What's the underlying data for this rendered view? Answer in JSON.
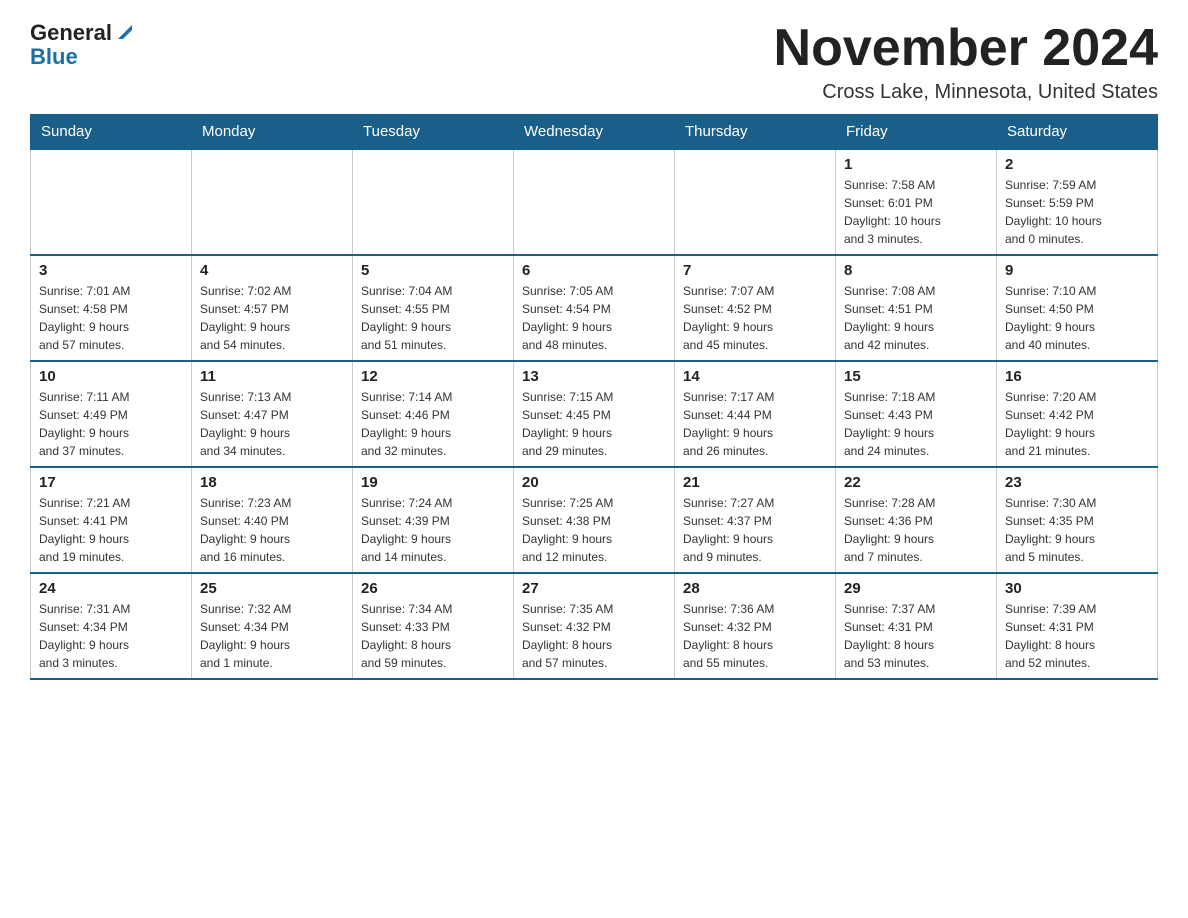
{
  "header": {
    "logo_general": "General",
    "logo_blue": "Blue",
    "title": "November 2024",
    "subtitle": "Cross Lake, Minnesota, United States"
  },
  "weekdays": [
    "Sunday",
    "Monday",
    "Tuesday",
    "Wednesday",
    "Thursday",
    "Friday",
    "Saturday"
  ],
  "weeks": [
    [
      {
        "day": "",
        "info": ""
      },
      {
        "day": "",
        "info": ""
      },
      {
        "day": "",
        "info": ""
      },
      {
        "day": "",
        "info": ""
      },
      {
        "day": "",
        "info": ""
      },
      {
        "day": "1",
        "info": "Sunrise: 7:58 AM\nSunset: 6:01 PM\nDaylight: 10 hours\nand 3 minutes."
      },
      {
        "day": "2",
        "info": "Sunrise: 7:59 AM\nSunset: 5:59 PM\nDaylight: 10 hours\nand 0 minutes."
      }
    ],
    [
      {
        "day": "3",
        "info": "Sunrise: 7:01 AM\nSunset: 4:58 PM\nDaylight: 9 hours\nand 57 minutes."
      },
      {
        "day": "4",
        "info": "Sunrise: 7:02 AM\nSunset: 4:57 PM\nDaylight: 9 hours\nand 54 minutes."
      },
      {
        "day": "5",
        "info": "Sunrise: 7:04 AM\nSunset: 4:55 PM\nDaylight: 9 hours\nand 51 minutes."
      },
      {
        "day": "6",
        "info": "Sunrise: 7:05 AM\nSunset: 4:54 PM\nDaylight: 9 hours\nand 48 minutes."
      },
      {
        "day": "7",
        "info": "Sunrise: 7:07 AM\nSunset: 4:52 PM\nDaylight: 9 hours\nand 45 minutes."
      },
      {
        "day": "8",
        "info": "Sunrise: 7:08 AM\nSunset: 4:51 PM\nDaylight: 9 hours\nand 42 minutes."
      },
      {
        "day": "9",
        "info": "Sunrise: 7:10 AM\nSunset: 4:50 PM\nDaylight: 9 hours\nand 40 minutes."
      }
    ],
    [
      {
        "day": "10",
        "info": "Sunrise: 7:11 AM\nSunset: 4:49 PM\nDaylight: 9 hours\nand 37 minutes."
      },
      {
        "day": "11",
        "info": "Sunrise: 7:13 AM\nSunset: 4:47 PM\nDaylight: 9 hours\nand 34 minutes."
      },
      {
        "day": "12",
        "info": "Sunrise: 7:14 AM\nSunset: 4:46 PM\nDaylight: 9 hours\nand 32 minutes."
      },
      {
        "day": "13",
        "info": "Sunrise: 7:15 AM\nSunset: 4:45 PM\nDaylight: 9 hours\nand 29 minutes."
      },
      {
        "day": "14",
        "info": "Sunrise: 7:17 AM\nSunset: 4:44 PM\nDaylight: 9 hours\nand 26 minutes."
      },
      {
        "day": "15",
        "info": "Sunrise: 7:18 AM\nSunset: 4:43 PM\nDaylight: 9 hours\nand 24 minutes."
      },
      {
        "day": "16",
        "info": "Sunrise: 7:20 AM\nSunset: 4:42 PM\nDaylight: 9 hours\nand 21 minutes."
      }
    ],
    [
      {
        "day": "17",
        "info": "Sunrise: 7:21 AM\nSunset: 4:41 PM\nDaylight: 9 hours\nand 19 minutes."
      },
      {
        "day": "18",
        "info": "Sunrise: 7:23 AM\nSunset: 4:40 PM\nDaylight: 9 hours\nand 16 minutes."
      },
      {
        "day": "19",
        "info": "Sunrise: 7:24 AM\nSunset: 4:39 PM\nDaylight: 9 hours\nand 14 minutes."
      },
      {
        "day": "20",
        "info": "Sunrise: 7:25 AM\nSunset: 4:38 PM\nDaylight: 9 hours\nand 12 minutes."
      },
      {
        "day": "21",
        "info": "Sunrise: 7:27 AM\nSunset: 4:37 PM\nDaylight: 9 hours\nand 9 minutes."
      },
      {
        "day": "22",
        "info": "Sunrise: 7:28 AM\nSunset: 4:36 PM\nDaylight: 9 hours\nand 7 minutes."
      },
      {
        "day": "23",
        "info": "Sunrise: 7:30 AM\nSunset: 4:35 PM\nDaylight: 9 hours\nand 5 minutes."
      }
    ],
    [
      {
        "day": "24",
        "info": "Sunrise: 7:31 AM\nSunset: 4:34 PM\nDaylight: 9 hours\nand 3 minutes."
      },
      {
        "day": "25",
        "info": "Sunrise: 7:32 AM\nSunset: 4:34 PM\nDaylight: 9 hours\nand 1 minute."
      },
      {
        "day": "26",
        "info": "Sunrise: 7:34 AM\nSunset: 4:33 PM\nDaylight: 8 hours\nand 59 minutes."
      },
      {
        "day": "27",
        "info": "Sunrise: 7:35 AM\nSunset: 4:32 PM\nDaylight: 8 hours\nand 57 minutes."
      },
      {
        "day": "28",
        "info": "Sunrise: 7:36 AM\nSunset: 4:32 PM\nDaylight: 8 hours\nand 55 minutes."
      },
      {
        "day": "29",
        "info": "Sunrise: 7:37 AM\nSunset: 4:31 PM\nDaylight: 8 hours\nand 53 minutes."
      },
      {
        "day": "30",
        "info": "Sunrise: 7:39 AM\nSunset: 4:31 PM\nDaylight: 8 hours\nand 52 minutes."
      }
    ]
  ]
}
